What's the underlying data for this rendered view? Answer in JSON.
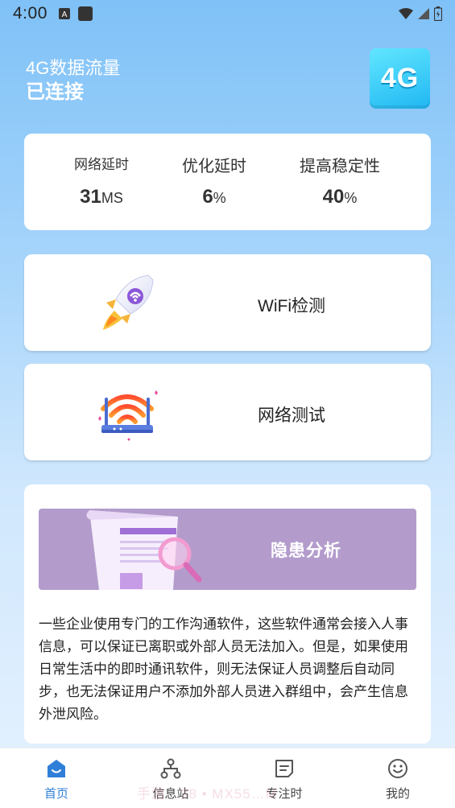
{
  "status_bar": {
    "time": "4:00",
    "icons_left": [
      "a-notification-icon",
      "square-app-icon"
    ],
    "icons_right": [
      "wifi-icon",
      "signal-icon",
      "battery-icon"
    ]
  },
  "header": {
    "title": "4G数据流量",
    "status": "已连接",
    "badge": "4G"
  },
  "stats": [
    {
      "label": "网络延时",
      "value": "31",
      "unit": "MS"
    },
    {
      "label": "优化延时",
      "value": "6",
      "unit": "%"
    },
    {
      "label": "提高稳定性",
      "value": "40",
      "unit": "%"
    }
  ],
  "features": [
    {
      "label": "WiFi检测",
      "icon": "rocket-icon"
    },
    {
      "label": "网络测试",
      "icon": "wifi-router-icon"
    }
  ],
  "analysis": {
    "banner_title": "隐患分析",
    "text": "一些企业使用专门的工作沟通软件，这些软件通常会接入人事信息，可以保证已离职或外部人员无法加入。但是，如果使用日常生活中的即时通讯软件，则无法保证人员调整后自动同步，也无法保证用户不添加外部人员进入群组中，会产生信息外泄风险。"
  },
  "bottom_nav": {
    "items": [
      {
        "label": "首页",
        "icon": "home-icon",
        "active": true
      },
      {
        "label": "信息站",
        "icon": "hierarchy-icon",
        "active": false
      },
      {
        "label": "专注时",
        "icon": "note-icon",
        "active": false
      },
      {
        "label": "我的",
        "icon": "smile-icon",
        "active": false
      }
    ],
    "watermark": "手游…38 • MX55…M"
  },
  "colors": {
    "accent": "#2f7fd8",
    "banner": "#b39ccc",
    "badge": "#1fb7f2"
  }
}
